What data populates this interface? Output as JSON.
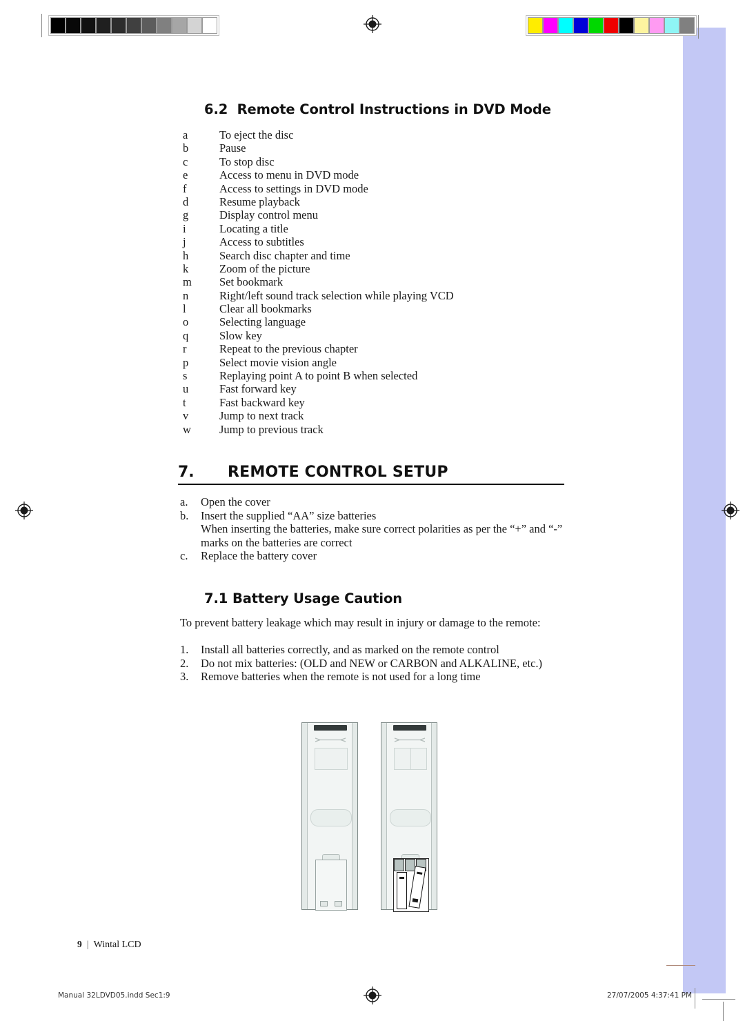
{
  "document": {
    "section_62": {
      "number": "6.2",
      "title": "Remote Control Instructions in DVD Mode",
      "items": [
        {
          "key": "a",
          "text": "To eject the disc"
        },
        {
          "key": "b",
          "text": "Pause"
        },
        {
          "key": "c",
          "text": "To stop disc"
        },
        {
          "key": "e",
          "text": "Access to menu in DVD mode"
        },
        {
          "key": "f",
          "text": "Access to settings in DVD mode"
        },
        {
          "key": "d",
          "text": "Resume playback"
        },
        {
          "key": "g",
          "text": "Display control menu"
        },
        {
          "key": "i",
          "text": "Locating a title"
        },
        {
          "key": "j",
          "text": "Access to subtitles"
        },
        {
          "key": "h",
          "text": "Search disc chapter and time"
        },
        {
          "key": "k",
          "text": "Zoom of the picture"
        },
        {
          "key": "m",
          "text": "Set bookmark"
        },
        {
          "key": "n",
          "text": "Right/left sound track selection while playing VCD"
        },
        {
          "key": "l",
          "text": "Clear all bookmarks"
        },
        {
          "key": "o",
          "text": "Selecting language"
        },
        {
          "key": "q",
          "text": "Slow key"
        },
        {
          "key": "r",
          "text": "Repeat to the previous chapter"
        },
        {
          "key": "p",
          "text": "Select movie vision angle"
        },
        {
          "key": "s",
          "text": "Replaying point A to point B when selected"
        },
        {
          "key": "u",
          "text": "Fast forward key"
        },
        {
          "key": "t",
          "text": "Fast backward key"
        },
        {
          "key": "v",
          "text": "Jump to next track"
        },
        {
          "key": "w",
          "text": "Jump to previous track"
        }
      ]
    },
    "section_7": {
      "number": "7.",
      "title": "REMOTE CONTROL SETUP",
      "steps": [
        {
          "key": "a.",
          "text": "Open the cover"
        },
        {
          "key": "b.",
          "text": "Insert the supplied “AA” size batteries"
        },
        {
          "key": "",
          "text": "When inserting the batteries, make sure correct polarities as per the “+” and “-”"
        },
        {
          "key": "",
          "text": "marks on the batteries are correct"
        },
        {
          "key": "c.",
          "text": "Replace the battery cover"
        }
      ]
    },
    "section_71": {
      "number": "7.1",
      "title": "Battery Usage Caution",
      "intro": "To prevent battery leakage which may result in injury or damage to the remote:",
      "items": [
        {
          "key": "1.",
          "text": "Install all batteries correctly, and as marked on the remote control"
        },
        {
          "key": "2.",
          "text": "Do not mix batteries: (OLD and NEW or CARBON and ALKALINE, etc.)"
        },
        {
          "key": "3.",
          "text": "Remove batteries when the remote is not used for a long time"
        }
      ]
    }
  },
  "footer": {
    "page_number": "9",
    "separator": "|",
    "product": "Wintal LCD"
  },
  "print_footer": {
    "left": "Manual 32LDVD05.indd   Sec1:9",
    "right": "27/07/2005   4:37:41 PM"
  },
  "print_marks": {
    "grayscale_patches": [
      "#000000",
      "#080808",
      "#111111",
      "#1f1f1f",
      "#2c2c2c",
      "#404040",
      "#5c5c5c",
      "#808080",
      "#a6a6a6",
      "#d4d4d4",
      "#ffffff"
    ],
    "color_patches": [
      "#ffed00",
      "#ff00ff",
      "#00ffff",
      "#0000d8",
      "#00d800",
      "#ee0000",
      "#000000",
      "#fdf4a0",
      "#ff9bf2",
      "#8ff5f5",
      "#808080"
    ],
    "band_color": "#c3c8f5"
  }
}
